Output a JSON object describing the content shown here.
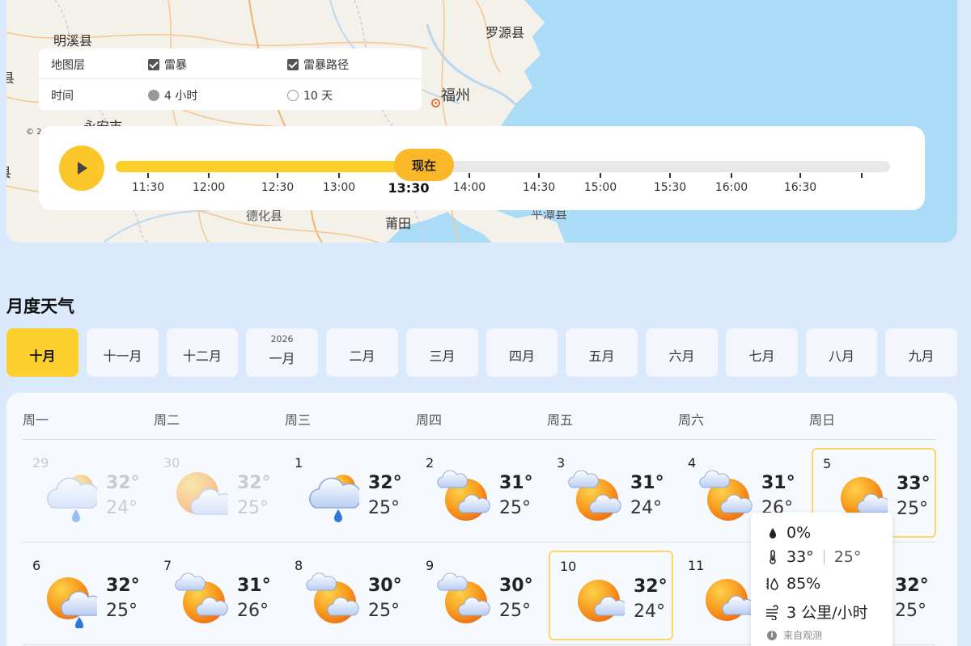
{
  "map": {
    "copyright": "© 2",
    "labels": [
      "明溪县",
      "罗源县",
      "福州",
      "永安市",
      "德化县",
      "莆田",
      "平潭县",
      "县",
      "县"
    ]
  },
  "layer_panel": {
    "layer_label": "地图层",
    "time_label": "时间",
    "thunderstorm": "雷暴",
    "storm_path": "雷暴路径",
    "range_4h": "4 小时",
    "range_10d": "10 天"
  },
  "timeline": {
    "now_label": "现在",
    "progress": 0.37,
    "ticks": [
      "11:30",
      "12:00",
      "12:30",
      "13:00",
      "13:30",
      "14:00",
      "14:30",
      "15:00",
      "15:30",
      "16:00",
      "16:30",
      ""
    ],
    "current_tick": "13:30"
  },
  "monthly": {
    "title": "月度天气",
    "year_label": "2026",
    "months": [
      "十月",
      "十一月",
      "十二月",
      "一月",
      "二月",
      "三月",
      "四月",
      "五月",
      "六月",
      "七月",
      "八月",
      "九月"
    ],
    "active_month": "十月",
    "weekdays": [
      "周一",
      "周二",
      "周三",
      "周四",
      "周五",
      "周六",
      "周日"
    ],
    "days": [
      {
        "day": "29",
        "hi": "32°",
        "lo": "24°",
        "icon": "rain-sun-icon",
        "past": true
      },
      {
        "day": "30",
        "hi": "32°",
        "lo": "25°",
        "icon": "cloud-sun-icon",
        "past": true
      },
      {
        "day": "1",
        "hi": "32°",
        "lo": "25°",
        "icon": "rain-sun-icon",
        "past": false
      },
      {
        "day": "2",
        "hi": "31°",
        "lo": "25°",
        "icon": "sun-clouds-icon",
        "past": false
      },
      {
        "day": "3",
        "hi": "31°",
        "lo": "24°",
        "icon": "sun-clouds-icon",
        "past": false
      },
      {
        "day": "4",
        "hi": "31°",
        "lo": "26°",
        "icon": "sun-clouds-icon",
        "past": false
      },
      {
        "day": "5",
        "hi": "33°",
        "lo": "25°",
        "icon": "sun-cloud-icon",
        "past": false
      },
      {
        "day": "6",
        "hi": "32°",
        "lo": "25°",
        "icon": "sun-rain-icon",
        "past": false
      },
      {
        "day": "7",
        "hi": "31°",
        "lo": "26°",
        "icon": "sun-clouds-icon",
        "past": false
      },
      {
        "day": "8",
        "hi": "30°",
        "lo": "25°",
        "icon": "sun-clouds-icon",
        "past": false
      },
      {
        "day": "9",
        "hi": "30°",
        "lo": "25°",
        "icon": "sun-clouds-icon",
        "past": false
      },
      {
        "day": "10",
        "hi": "32°",
        "lo": "24°",
        "icon": "sun-cloud-icon",
        "past": false
      },
      {
        "day": "11",
        "hi": "",
        "lo": "",
        "icon": "sun-cloud-icon",
        "past": false
      },
      {
        "day": "",
        "hi": "32°",
        "lo": "25°",
        "icon": "",
        "past": false
      }
    ]
  },
  "tooltip": {
    "precip": "0%",
    "hi": "33°",
    "lo": "25°",
    "humidity": "85%",
    "wind": "3 公里/小时",
    "source": "来自观测"
  },
  "colors": {
    "accent_yellow": "#fccf2c",
    "now_orange": "#fbb72a",
    "page_bg": "#dbe9fd",
    "sea": "#abdcf7"
  }
}
